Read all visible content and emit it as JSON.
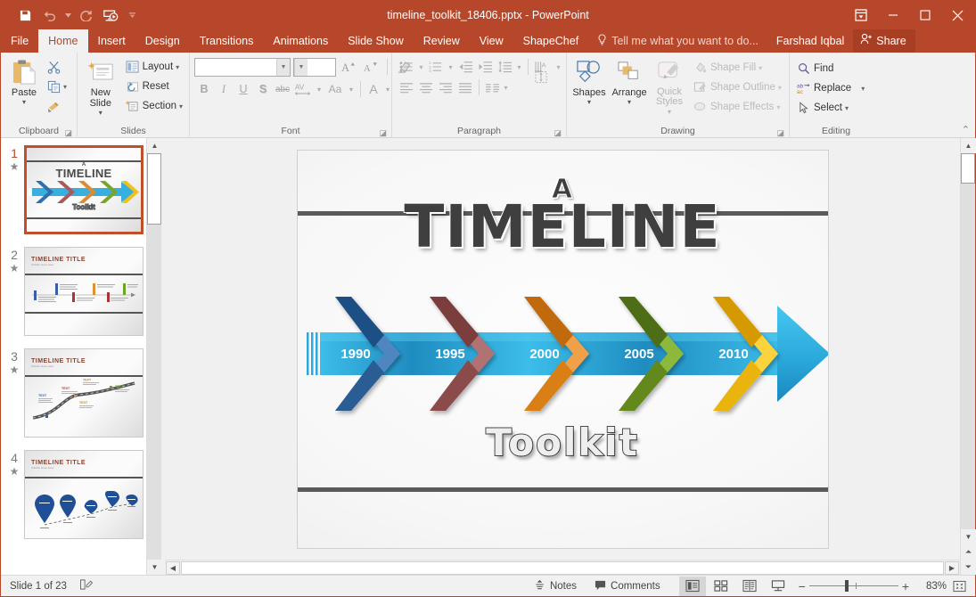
{
  "titlebar": {
    "document_title": "timeline_toolkit_18406.pptx - PowerPoint",
    "qat": [
      {
        "name": "save",
        "label": "Save"
      },
      {
        "name": "undo",
        "label": "Undo"
      },
      {
        "name": "redo",
        "label": "Redo"
      },
      {
        "name": "start-from-beginning",
        "label": "Start From Beginning"
      },
      {
        "name": "customize-qat",
        "label": "Customize Quick Access Toolbar"
      }
    ],
    "window_controls": [
      {
        "name": "ribbon-display-options",
        "label": "Ribbon Display Options"
      },
      {
        "name": "minimize",
        "label": "Minimize"
      },
      {
        "name": "restore",
        "label": "Restore Down"
      },
      {
        "name": "close",
        "label": "Close"
      }
    ]
  },
  "tabs": [
    {
      "label": "File",
      "active": false
    },
    {
      "label": "Home",
      "active": true
    },
    {
      "label": "Insert",
      "active": false
    },
    {
      "label": "Design",
      "active": false
    },
    {
      "label": "Transitions",
      "active": false
    },
    {
      "label": "Animations",
      "active": false
    },
    {
      "label": "Slide Show",
      "active": false
    },
    {
      "label": "Review",
      "active": false
    },
    {
      "label": "View",
      "active": false
    },
    {
      "label": "ShapeChef",
      "active": false
    }
  ],
  "tellme": {
    "placeholder": "Tell me what you want to do..."
  },
  "account": {
    "name": "Farshad Iqbal"
  },
  "share": {
    "label": "Share"
  },
  "ribbon": {
    "groups": [
      {
        "name": "clipboard",
        "label": "Clipboard",
        "items": [
          {
            "label": "Paste",
            "name": "paste-button"
          },
          {
            "label": "Cut",
            "name": "cut-button"
          },
          {
            "label": "Copy",
            "name": "copy-button"
          },
          {
            "label": "Format Painter",
            "name": "format-painter-button"
          }
        ]
      },
      {
        "name": "slides",
        "label": "Slides",
        "items": [
          {
            "label": "New Slide",
            "name": "new-slide-button"
          },
          {
            "label": "Layout",
            "name": "layout-button"
          },
          {
            "label": "Reset",
            "name": "reset-button"
          },
          {
            "label": "Section",
            "name": "section-button"
          }
        ]
      },
      {
        "name": "font",
        "label": "Font",
        "font_name_value": "",
        "font_size_value": "",
        "items": [
          {
            "label": "B",
            "name": "bold-button"
          },
          {
            "label": "I",
            "name": "italic-button"
          },
          {
            "label": "U",
            "name": "underline-button"
          },
          {
            "label": "S",
            "name": "text-shadow-button"
          },
          {
            "label": "abc",
            "name": "strikethrough-button"
          },
          {
            "label": "AV",
            "name": "character-spacing-button"
          },
          {
            "label": "Aa",
            "name": "change-case-button"
          },
          {
            "label": "A",
            "name": "font-color-button"
          },
          {
            "label": "A↑",
            "name": "increase-font-size-button"
          },
          {
            "label": "A↓",
            "name": "decrease-font-size-button"
          },
          {
            "label": "Clear Formatting",
            "name": "clear-formatting-button"
          }
        ]
      },
      {
        "name": "paragraph",
        "label": "Paragraph",
        "items": [
          {
            "label": "Bullets",
            "name": "bullets-button"
          },
          {
            "label": "Numbering",
            "name": "numbering-button"
          },
          {
            "label": "Decrease Indent",
            "name": "decrease-indent-button"
          },
          {
            "label": "Increase Indent",
            "name": "increase-indent-button"
          },
          {
            "label": "Line Spacing",
            "name": "line-spacing-button"
          },
          {
            "label": "Text Direction",
            "name": "text-direction-button"
          },
          {
            "label": "Align Text",
            "name": "align-text-button"
          },
          {
            "label": "Convert to SmartArt",
            "name": "convert-to-smartart-button"
          },
          {
            "label": "Align Left",
            "name": "align-left-button"
          },
          {
            "label": "Center",
            "name": "align-center-button"
          },
          {
            "label": "Align Right",
            "name": "align-right-button"
          },
          {
            "label": "Justify",
            "name": "justify-button"
          },
          {
            "label": "Columns",
            "name": "columns-button"
          }
        ]
      },
      {
        "name": "drawing",
        "label": "Drawing",
        "items": [
          {
            "label": "Shapes",
            "name": "shapes-button"
          },
          {
            "label": "Arrange",
            "name": "arrange-button"
          },
          {
            "label": "Quick Styles",
            "name": "quick-styles-button"
          },
          {
            "label": "Shape Fill",
            "name": "shape-fill-button"
          },
          {
            "label": "Shape Outline",
            "name": "shape-outline-button"
          },
          {
            "label": "Shape Effects",
            "name": "shape-effects-button"
          }
        ]
      },
      {
        "name": "editing",
        "label": "Editing",
        "items": [
          {
            "label": "Find",
            "name": "find-button"
          },
          {
            "label": "Replace",
            "name": "replace-button"
          },
          {
            "label": "Select",
            "name": "select-button"
          }
        ]
      }
    ],
    "collapse_label": "Collapse the Ribbon"
  },
  "thumbnails": [
    {
      "number": "1",
      "selected": true,
      "starred": true,
      "kind": "timeline-title",
      "title_a": "A",
      "title_main": "TIMELINE",
      "subtitle": "Toolkit"
    },
    {
      "number": "2",
      "selected": false,
      "starred": true,
      "kind": "markers",
      "title": "TIMELINE TITLE",
      "subtitle": "Subtitle Goes Here"
    },
    {
      "number": "3",
      "selected": false,
      "starred": true,
      "kind": "road",
      "title": "TIMELINE TITLE",
      "subtitle": "Subtitle Goes Here"
    },
    {
      "number": "4",
      "selected": false,
      "starred": true,
      "kind": "pins",
      "title": "TIMELINE TITLE",
      "subtitle": "Subtitle Goes Here"
    }
  ],
  "slide": {
    "title_a": "A",
    "title_main": "TIMELINE",
    "subtitle": "Toolkit",
    "arrow_band_color": "#29a3d8",
    "milestones": [
      {
        "label": "1990",
        "color": "#2f6fad",
        "dark": "#1d4f83",
        "light": "#5c93cc"
      },
      {
        "label": "1995",
        "color": "#a85b5b",
        "dark": "#7c3c3c",
        "light": "#c08585"
      },
      {
        "label": "2000",
        "color": "#e08a2e",
        "dark": "#c06a10",
        "light": "#f0a95a"
      },
      {
        "label": "2005",
        "color": "#7aa52a",
        "dark": "#4f6d12",
        "light": "#9dc24d"
      },
      {
        "label": "2010",
        "color": "#f2c018",
        "dark": "#d49a00",
        "light": "#fbd54e"
      }
    ]
  },
  "statusbar": {
    "slide_indicator": "Slide 1 of 23",
    "notes_label": "Notes",
    "comments_label": "Comments",
    "zoom_level": "83%",
    "views": [
      {
        "name": "normal-view-button",
        "label": "Normal",
        "active": true
      },
      {
        "name": "slide-sorter-view-button",
        "label": "Slide Sorter",
        "active": false
      },
      {
        "name": "reading-view-button",
        "label": "Reading View",
        "active": false
      },
      {
        "name": "slide-show-button",
        "label": "Slide Show",
        "active": false
      }
    ],
    "zoom_out_label": "−",
    "zoom_in_label": "+",
    "fit_label": "Fit slide to current window",
    "notes_icon_label": "Notes"
  }
}
